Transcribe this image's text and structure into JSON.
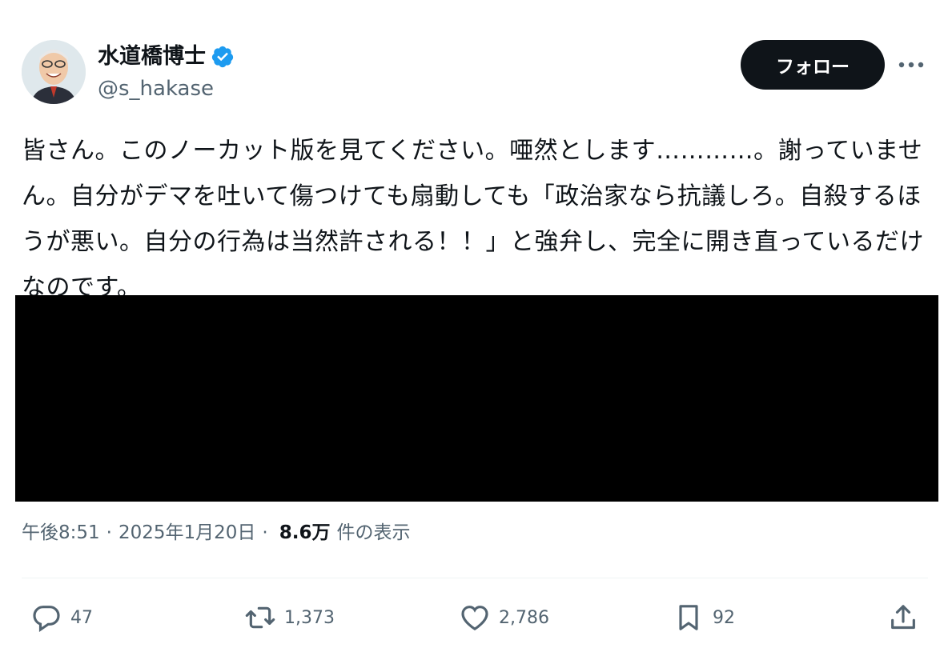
{
  "author": {
    "display_name": "水道橋博士",
    "handle": "@s_hakase"
  },
  "header": {
    "follow_label": "フォロー"
  },
  "tweet": {
    "text": "皆さん。このノーカット版を見てください。唖然とします…………。謝っていません。自分がデマを吐いて傷つけても扇動しても「政治家なら抗議しろ。自殺するほうが悪い。自分の行為は当然許される！！」と強弁し、完全に開き直っているだけなのです。"
  },
  "meta": {
    "time": "午後8:51",
    "separator": "·",
    "date": "2025年1月20日",
    "views": "8.6万",
    "views_label": "件の表示"
  },
  "actions": {
    "replies": "47",
    "retweets": "1,373",
    "likes": "2,786",
    "bookmarks": "92"
  },
  "colors": {
    "text": "#0f1419",
    "secondary": "#536471",
    "verified": "#1d9bf0",
    "media": "#000000"
  },
  "icons": [
    "verified-badge-icon",
    "more-icon",
    "reply-icon",
    "retweet-icon",
    "like-icon",
    "bookmark-icon",
    "share-icon"
  ]
}
